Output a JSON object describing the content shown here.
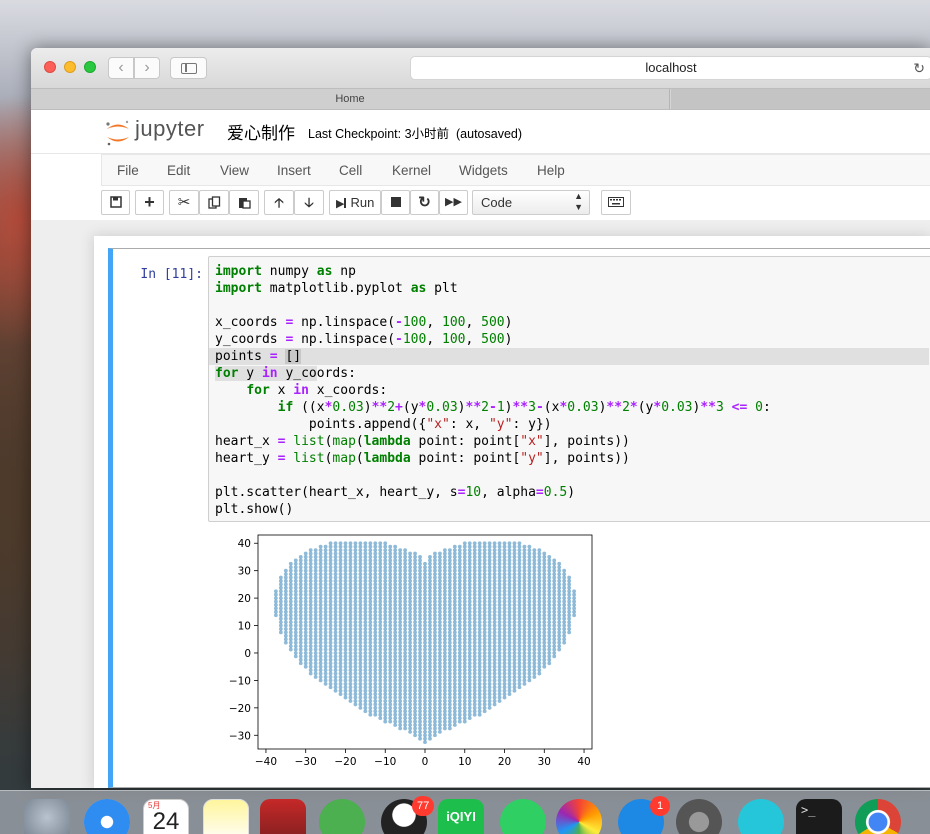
{
  "browser": {
    "url": "localhost",
    "tab_title": "Home"
  },
  "notebook": {
    "logo_text": "jupyter",
    "name": "爱心制作",
    "checkpoint": "Last Checkpoint: 3小时前",
    "autosave": "(autosaved)"
  },
  "menu": [
    "File",
    "Edit",
    "View",
    "Insert",
    "Cell",
    "Kernel",
    "Widgets",
    "Help"
  ],
  "toolbar": {
    "run_label": "Run",
    "cell_type": "Code",
    "icons": [
      "save-icon",
      "plus-icon",
      "cut-icon",
      "copy-icon",
      "paste-icon",
      "arrow-up-icon",
      "arrow-down-icon",
      "play-icon",
      "stop-icon",
      "restart-icon",
      "fast-forward-icon",
      "keyboard-icon"
    ]
  },
  "cell": {
    "prompt": "In [11]:"
  },
  "chart_data": {
    "type": "scatter",
    "title": "",
    "xlabel": "",
    "ylabel": "",
    "xlim": [
      -42,
      42
    ],
    "ylim": [
      -35,
      43
    ],
    "xticks": [
      -40,
      -30,
      -20,
      -10,
      0,
      10,
      20,
      30,
      40
    ],
    "yticks": [
      -30,
      -20,
      -10,
      0,
      10,
      20,
      30,
      40
    ],
    "xtick_labels": [
      "−40",
      "−30",
      "−20",
      "−10",
      "0",
      "10",
      "20",
      "30",
      "40"
    ],
    "ytick_labels": [
      "−30",
      "−20",
      "−10",
      "0",
      "10",
      "20",
      "30",
      "40"
    ],
    "marker_color": "#1f77b4",
    "alpha": 0.5,
    "marker_size": 10,
    "series": [
      {
        "shape": "heart",
        "x_range": [
          -38.5,
          38.5
        ],
        "y_range": [
          -33,
          41
        ]
      }
    ]
  },
  "dock": {
    "calendar_month": "5月",
    "calendar_day": "24",
    "qq_badge": "77",
    "appstore_badge": "1",
    "iqiyi_label": "iQIYI",
    "terminal_glyph": ">_",
    "apps": [
      "rocket-icon",
      "safari-icon",
      "calendar-icon",
      "notes-icon",
      "photo-booth-icon",
      "wechat-icon",
      "qq-icon",
      "iqiyi-icon",
      "music-icon",
      "photos-icon",
      "app-store-icon",
      "system-preferences-icon",
      "c-app-icon",
      "terminal-icon",
      "chrome-icon"
    ]
  }
}
